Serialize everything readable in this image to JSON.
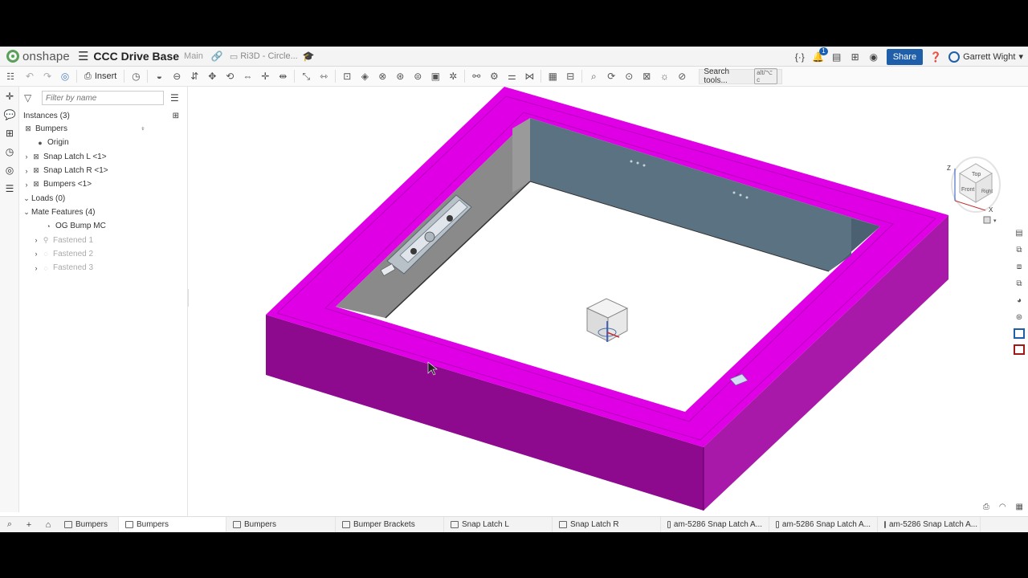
{
  "header": {
    "logo_text": "onshape",
    "doc_title": "CCC Drive Base",
    "branch": "Main",
    "folder": "Ri3D - Circle...",
    "notification_count": "1",
    "share_label": "Share",
    "user_name": "Garrett Wight"
  },
  "toolbar": {
    "insert_label": "Insert",
    "search_label": "Search tools...",
    "search_shortcut": "alt/⌥ c"
  },
  "panel": {
    "filter_placeholder": "Filter by name",
    "instances_header": "Instances (3)",
    "tree": [
      {
        "label": "Bumpers",
        "icon": "assembly-icon",
        "muted": false
      },
      {
        "label": "Origin",
        "icon": "origin-dot-icon",
        "muted": false
      },
      {
        "label": "Snap Latch L <1>",
        "icon": "assembly-icon",
        "muted": false
      },
      {
        "label": "Snap Latch R <1>",
        "icon": "assembly-icon",
        "muted": false
      },
      {
        "label": "Bumpers <1>",
        "icon": "assembly-icon",
        "muted": false
      },
      {
        "label": "Loads (0)",
        "icon": "",
        "muted": false
      },
      {
        "label": "Mate Features (4)",
        "icon": "",
        "muted": false
      },
      {
        "label": "OG Bump MC",
        "icon": "mate-connector-icon",
        "muted": false
      },
      {
        "label": "Fastened 1",
        "icon": "fastened-mate-icon",
        "muted": true
      },
      {
        "label": "Fastened 2",
        "icon": "fastened-mate-icon",
        "muted": true
      },
      {
        "label": "Fastened 3",
        "icon": "fastened-mate-icon",
        "muted": true
      }
    ]
  },
  "view_cube": {
    "top_label": "Top",
    "front_label": "Front",
    "right_label": "Right",
    "axis_z": "Z",
    "axis_x": "X"
  },
  "tabs": [
    {
      "label": "Bumpers",
      "type": "folder"
    },
    {
      "label": "Bumpers",
      "type": "assembly"
    },
    {
      "label": "Bumpers",
      "type": "part-studio"
    },
    {
      "label": "Bumper Brackets",
      "type": "part-studio"
    },
    {
      "label": "Snap Latch L",
      "type": "part-studio"
    },
    {
      "label": "Snap Latch R",
      "type": "part-studio"
    },
    {
      "label": "am-5286 Snap Latch A...",
      "type": "part-studio"
    },
    {
      "label": "am-5286 Snap Latch A...",
      "type": "part-studio"
    },
    {
      "label": "am-5286 Snap Latch A...",
      "type": "drawing"
    }
  ],
  "colors": {
    "bumper_top": "#e000e6",
    "bumper_side_dark": "#8c0a8e",
    "bumper_side_mid": "#a91aab",
    "wall_inner": "#5b7283",
    "accent_blue": "#1f5fa9",
    "onshape_green": "#5aa05a"
  }
}
